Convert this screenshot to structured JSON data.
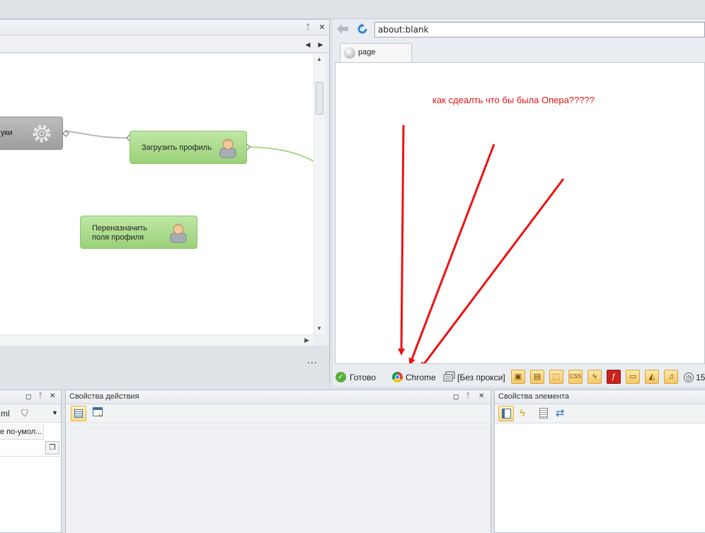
{
  "workflow": {
    "node_start_label": "уки",
    "node_load_label": "Загрузить профиль",
    "node_reassign_label_line1": "Переназначить",
    "node_reassign_label_line2": "поля профиля",
    "more_label": "..."
  },
  "browser": {
    "address": "about:blank",
    "tab_label": "page",
    "annotation": "как сдеалть что бы была Опера?????"
  },
  "status": {
    "ready": "Готово",
    "browser_name": "Chrome",
    "proxy": "[Без прокси]",
    "time_partial": "15"
  },
  "panels": {
    "left_bottom": {
      "filter_text": "ml",
      "column_header": "е по-умол..."
    },
    "action_props_title": "Свойства действия",
    "element_props_title": "Свойства элемента"
  },
  "colors": {
    "annotation_red": "#ee1111",
    "node_green": "#a9dc86",
    "node_gray": "#a8a8a8",
    "link_green": "#a8d98a"
  }
}
